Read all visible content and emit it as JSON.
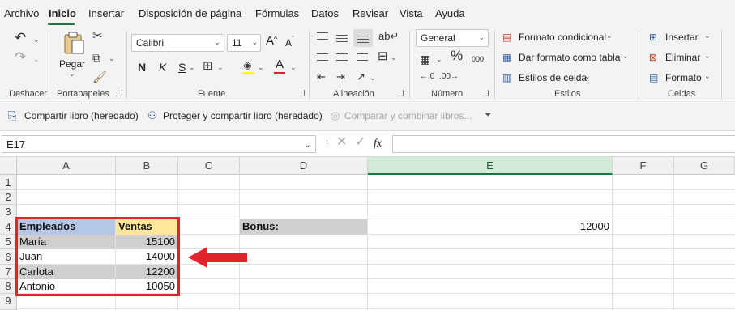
{
  "menu": {
    "tabs": [
      "Archivo",
      "Inicio",
      "Insertar",
      "Disposición de página",
      "Fórmulas",
      "Datos",
      "Revisar",
      "Vista",
      "Ayuda"
    ],
    "active": "Inicio"
  },
  "ribbon": {
    "undo_group": "Deshacer",
    "clipboard": {
      "paste": "Pegar",
      "group": "Portapapeles"
    },
    "font": {
      "name": "Calibri",
      "size": "11",
      "bold": "N",
      "italic": "K",
      "underline": "S",
      "grow": "A",
      "shrink": "A",
      "color_letter": "A",
      "group": "Fuente"
    },
    "alignment": {
      "group": "Alineación"
    },
    "number": {
      "format": "General",
      "percent": "%",
      "thousands": "000",
      "group": "Número"
    },
    "styles": {
      "conditional": "Formato condicional",
      "as_table": "Dar formato como tabla",
      "cell_styles": "Estilos de celda",
      "group": "Estilos"
    },
    "cells": {
      "insert": "Insertar",
      "delete": "Eliminar",
      "format": "Formato",
      "group": "Celdas"
    }
  },
  "sharebar": {
    "share": "Compartir libro (heredado)",
    "protect": "Proteger y compartir libro (heredado)",
    "compare": "Comparar y combinar libros..."
  },
  "formula_bar": {
    "name_box": "E17",
    "fx": "fx",
    "value": ""
  },
  "sheet": {
    "columns": [
      "A",
      "B",
      "C",
      "D",
      "E",
      "F",
      "G"
    ],
    "selected_column": "E",
    "rows": [
      "1",
      "2",
      "3",
      "4",
      "5",
      "6",
      "7",
      "8",
      "9"
    ],
    "table": {
      "header": [
        "Empleados",
        "Ventas"
      ],
      "rows": [
        {
          "name": "María",
          "sales": "15100"
        },
        {
          "name": "Juan",
          "sales": "14000"
        },
        {
          "name": "Carlota",
          "sales": "12200"
        },
        {
          "name": "Antonio",
          "sales": "10050"
        }
      ]
    },
    "bonus_label": "Bonus:",
    "bonus_value": "12000"
  },
  "colors": {
    "accent": "#217346",
    "header_name_fill": "#b4c7e7",
    "header_sales_fill": "#ffe699",
    "band_fill": "#d0cece",
    "highlight_border": "#e0242b",
    "arrow": "#e0242b"
  }
}
